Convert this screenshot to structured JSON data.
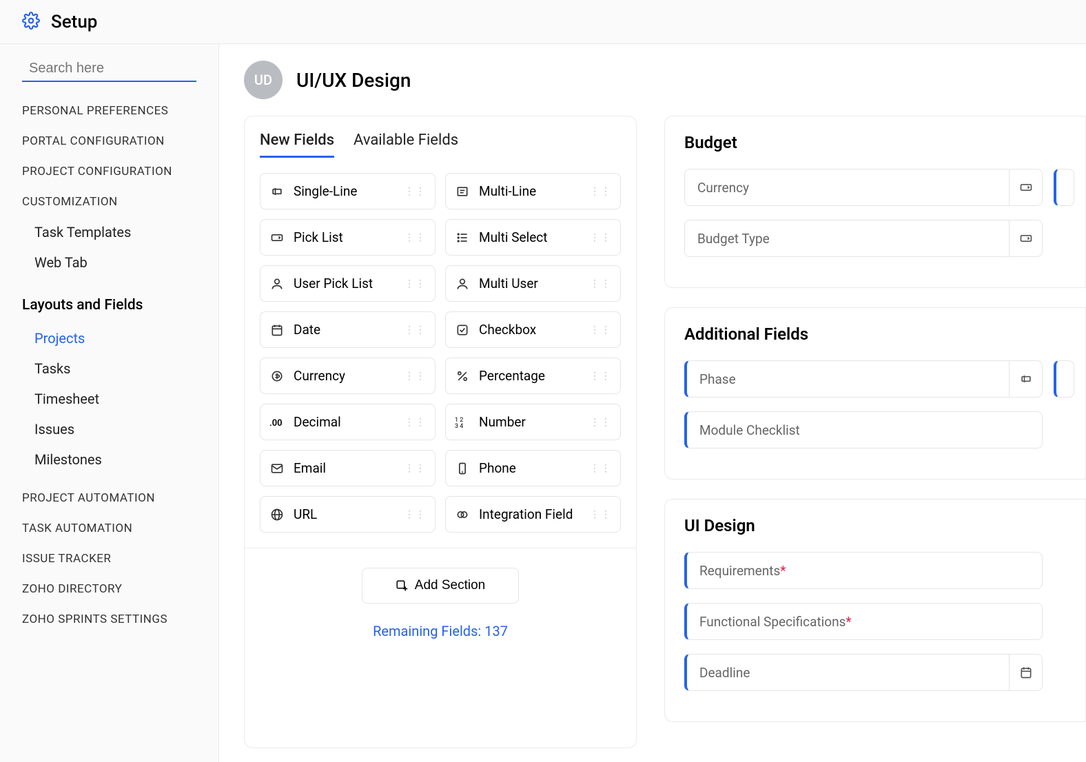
{
  "topbar": {
    "title": "Setup"
  },
  "sidebar": {
    "search_placeholder": "Search here",
    "sections_top": [
      "PERSONAL PREFERENCES",
      "PORTAL CONFIGURATION",
      "PROJECT CONFIGURATION",
      "CUSTOMIZATION"
    ],
    "customization_items": [
      "Task Templates",
      "Web Tab"
    ],
    "layouts_head": "Layouts and Fields",
    "layouts_items": [
      "Projects",
      "Tasks",
      "Timesheet",
      "Issues",
      "Milestones"
    ],
    "layouts_active_index": 0,
    "sections_bottom": [
      "PROJECT AUTOMATION",
      "TASK AUTOMATION",
      "ISSUE TRACKER",
      "ZOHO DIRECTORY",
      "ZOHO SPRINTS SETTINGS"
    ]
  },
  "header": {
    "avatar": "UD",
    "title": "UI/UX Design"
  },
  "fields_panel": {
    "tabs": [
      "New Fields",
      "Available Fields"
    ],
    "active_tab": 0,
    "items": [
      {
        "label": "Single-Line",
        "icon": "text"
      },
      {
        "label": "Multi-Line",
        "icon": "multiline"
      },
      {
        "label": "Pick List",
        "icon": "picklist"
      },
      {
        "label": "Multi Select",
        "icon": "multiselect"
      },
      {
        "label": "User Pick List",
        "icon": "user"
      },
      {
        "label": "Multi User",
        "icon": "user"
      },
      {
        "label": "Date",
        "icon": "date"
      },
      {
        "label": "Checkbox",
        "icon": "checkbox"
      },
      {
        "label": "Currency",
        "icon": "currency"
      },
      {
        "label": "Percentage",
        "icon": "percent"
      },
      {
        "label": "Decimal",
        "icon": "decimal"
      },
      {
        "label": "Number",
        "icon": "number"
      },
      {
        "label": "Email",
        "icon": "email"
      },
      {
        "label": "Phone",
        "icon": "phone"
      },
      {
        "label": "URL",
        "icon": "url"
      },
      {
        "label": "Integration Field",
        "icon": "integration"
      }
    ],
    "add_section_label": "Add Section",
    "remaining_label": "Remaining Fields: 137"
  },
  "layout_sections": [
    {
      "title": "Budget",
      "rows": [
        [
          {
            "label": "Currency",
            "accent": false,
            "righticon": "picklist",
            "required": false
          },
          {
            "stub": true
          }
        ],
        [
          {
            "label": "Budget Type",
            "accent": false,
            "righticon": "picklist",
            "required": false
          }
        ]
      ]
    },
    {
      "title": "Additional Fields",
      "rows": [
        [
          {
            "label": "Phase",
            "accent": true,
            "righticon": "text",
            "required": false
          },
          {
            "stub": true
          }
        ],
        [
          {
            "label": "Module Checklist",
            "accent": true,
            "righticon": null,
            "required": false
          }
        ]
      ]
    },
    {
      "title": "UI Design",
      "rows": [
        [
          {
            "label": "Requirements",
            "accent": true,
            "righticon": null,
            "required": true
          }
        ],
        [
          {
            "label": "Functional Specifications",
            "accent": true,
            "righticon": null,
            "required": true
          }
        ],
        [
          {
            "label": "Deadline",
            "accent": true,
            "righticon": "date",
            "required": false
          }
        ]
      ]
    }
  ]
}
